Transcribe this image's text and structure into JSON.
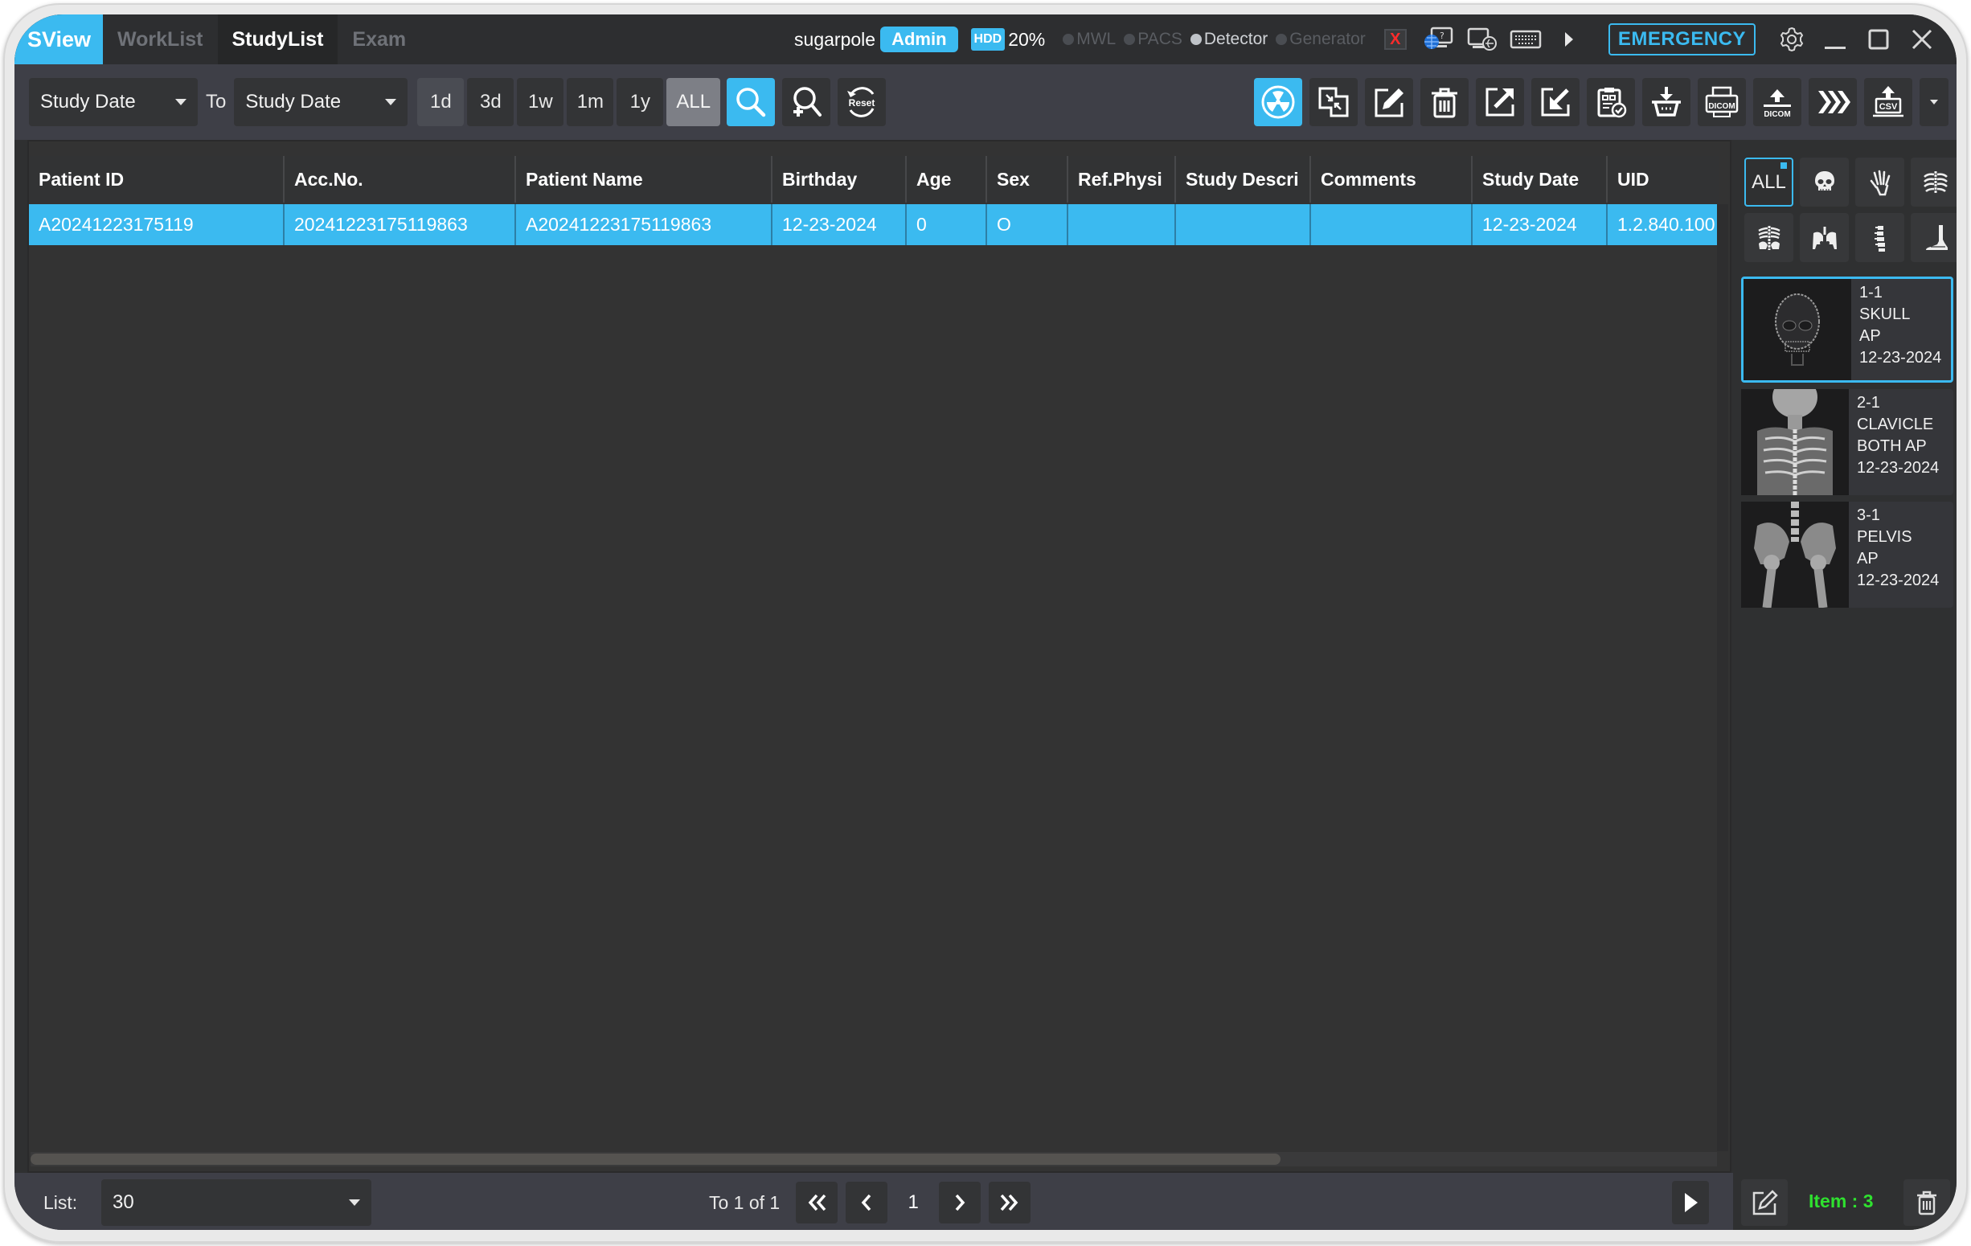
{
  "app": {
    "logo": "SView",
    "nav_tabs": [
      {
        "label": "WorkList",
        "active": false
      },
      {
        "label": "StudyList",
        "active": true
      },
      {
        "label": "Exam",
        "active": false
      }
    ],
    "user": "sugarpole",
    "role": "Admin",
    "hdd_badge": "HDD",
    "hdd_usage": "20%",
    "statuses": [
      {
        "label": "MWL",
        "on": false
      },
      {
        "label": "PACS",
        "on": false
      },
      {
        "label": "Detector",
        "on": true
      },
      {
        "label": "Generator",
        "on": false
      }
    ],
    "status_error_icon": "X",
    "emergency_label": "EMERGENCY",
    "accent_color": "#3bbaf0"
  },
  "toolbar": {
    "from_select": "Study Date",
    "to_label": "To",
    "to_select": "Study Date",
    "ranges": [
      "1d",
      "3d",
      "1w",
      "1m",
      "1y",
      "ALL"
    ],
    "active_range": "ALL",
    "search_icon": "search-icon",
    "advanced_search_icon": "search-plus-icon",
    "reset_label": "Reset",
    "actions": [
      "radiation-icon",
      "merge-icon",
      "edit-icon",
      "trash-icon",
      "export-icon",
      "import-icon",
      "report-check-icon",
      "basket-download-icon",
      "dicom-print-icon",
      "dicom-upload-icon",
      "fast-forward-icon",
      "csv-export-icon",
      "more-dropdown-icon"
    ],
    "dicom_label": "DICOM",
    "csv_label": "CSV"
  },
  "table": {
    "columns": [
      "Patient ID",
      "Acc.No.",
      "Patient Name",
      "Birthday",
      "Age",
      "Sex",
      "Ref.Physician",
      "Study Description",
      "Comments",
      "Study Date",
      "UID"
    ],
    "columns_display": [
      "Patient ID",
      "Acc.No.",
      "Patient Name",
      "Birthday",
      "Age",
      "Sex",
      "Ref.Physi",
      "Study Descri",
      "Comments",
      "Study Date",
      "UID"
    ],
    "rows": [
      {
        "selected": true,
        "cells": [
          "A20241223175119",
          "20241223175119863",
          "A20241223175119863",
          "12-23-2024",
          "0",
          "O",
          "",
          "",
          "",
          "12-23-2024",
          "1.2.840.100"
        ]
      }
    ],
    "row_highlight_color": "#3bbaf0"
  },
  "footer": {
    "list_label": "List:",
    "list_value": "30",
    "page_info": "To 1 of 1",
    "current_page": "1"
  },
  "right_panel": {
    "filters": [
      {
        "label": "ALL",
        "icon": "all",
        "active": true
      },
      {
        "label": "",
        "icon": "skull-icon",
        "active": false
      },
      {
        "label": "",
        "icon": "hand-icon",
        "active": false
      },
      {
        "label": "",
        "icon": "chest-icon",
        "active": false
      },
      {
        "label": "",
        "icon": "abdomen-icon",
        "active": false
      },
      {
        "label": "",
        "icon": "pelvis-icon",
        "active": false
      },
      {
        "label": "",
        "icon": "spine-icon",
        "active": false
      },
      {
        "label": "",
        "icon": "foot-icon",
        "active": false
      }
    ],
    "images": [
      {
        "index": "1-1",
        "body_part": "SKULL",
        "view": "AP",
        "date": "12-23-2024",
        "selected": true
      },
      {
        "index": "2-1",
        "body_part": "CLAVICLE",
        "view": "BOTH AP",
        "date": "12-23-2024",
        "selected": false
      },
      {
        "index": "3-1",
        "body_part": "PELVIS",
        "view": "AP",
        "date": "12-23-2024",
        "selected": false
      }
    ],
    "item_count_label": "Item : 3",
    "item_count_color": "#2fe12f"
  }
}
